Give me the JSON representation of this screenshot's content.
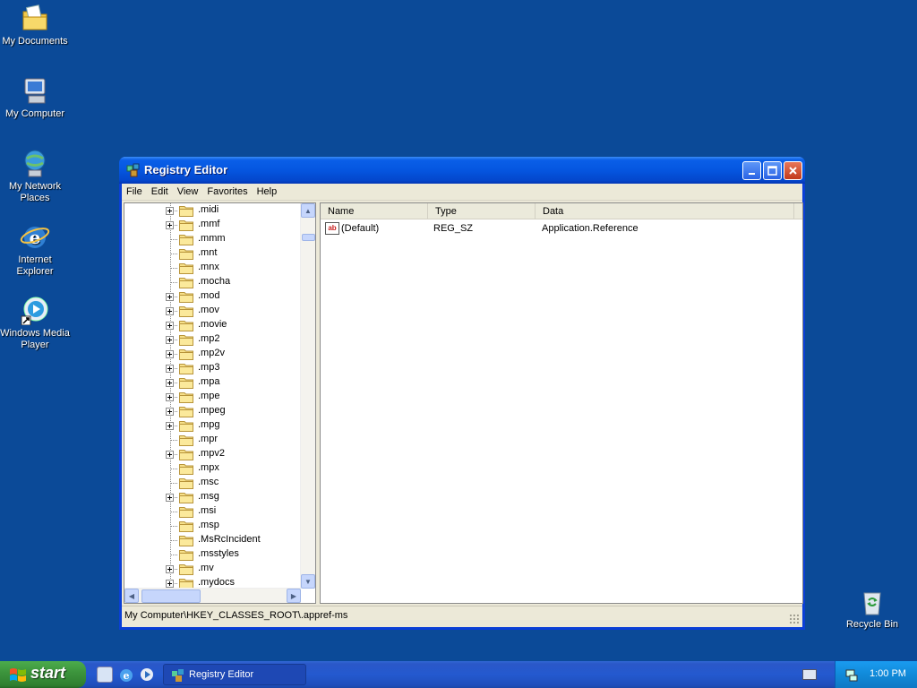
{
  "desktop": {
    "icons": [
      {
        "label": "My Documents"
      },
      {
        "label": "My Computer"
      },
      {
        "label": "My Network Places"
      },
      {
        "label": "Internet Explorer"
      },
      {
        "label": "Windows Media Player"
      }
    ],
    "recycle_bin": "Recycle Bin"
  },
  "window": {
    "title": "Registry Editor",
    "menu": [
      "File",
      "Edit",
      "View",
      "Favorites",
      "Help"
    ],
    "tree": [
      {
        "label": ".midi",
        "expandable": true
      },
      {
        "label": ".mmf",
        "expandable": true
      },
      {
        "label": ".mmm",
        "expandable": false
      },
      {
        "label": ".mnt",
        "expandable": false
      },
      {
        "label": ".mnx",
        "expandable": false
      },
      {
        "label": ".mocha",
        "expandable": false
      },
      {
        "label": ".mod",
        "expandable": true
      },
      {
        "label": ".mov",
        "expandable": true
      },
      {
        "label": ".movie",
        "expandable": true
      },
      {
        "label": ".mp2",
        "expandable": true
      },
      {
        "label": ".mp2v",
        "expandable": true
      },
      {
        "label": ".mp3",
        "expandable": true
      },
      {
        "label": ".mpa",
        "expandable": true
      },
      {
        "label": ".mpe",
        "expandable": true
      },
      {
        "label": ".mpeg",
        "expandable": true
      },
      {
        "label": ".mpg",
        "expandable": true
      },
      {
        "label": ".mpr",
        "expandable": false
      },
      {
        "label": ".mpv2",
        "expandable": true
      },
      {
        "label": ".mpx",
        "expandable": false
      },
      {
        "label": ".msc",
        "expandable": false
      },
      {
        "label": ".msg",
        "expandable": true
      },
      {
        "label": ".msi",
        "expandable": false
      },
      {
        "label": ".msp",
        "expandable": false
      },
      {
        "label": ".MsRcIncident",
        "expandable": false
      },
      {
        "label": ".msstyles",
        "expandable": false
      },
      {
        "label": ".mv",
        "expandable": true
      },
      {
        "label": ".mydocs",
        "expandable": true
      }
    ],
    "columns": {
      "name": "Name",
      "type": "Type",
      "data": "Data"
    },
    "rows": [
      {
        "name": "(Default)",
        "type": "REG_SZ",
        "data": "Application.Reference",
        "icon": "string-value-icon"
      }
    ],
    "status": "My Computer\\HKEY_CLASSES_ROOT\\.appref-ms"
  },
  "taskbar": {
    "start_label": "start",
    "task_label": "Registry Editor",
    "clock": "1:00 PM"
  }
}
